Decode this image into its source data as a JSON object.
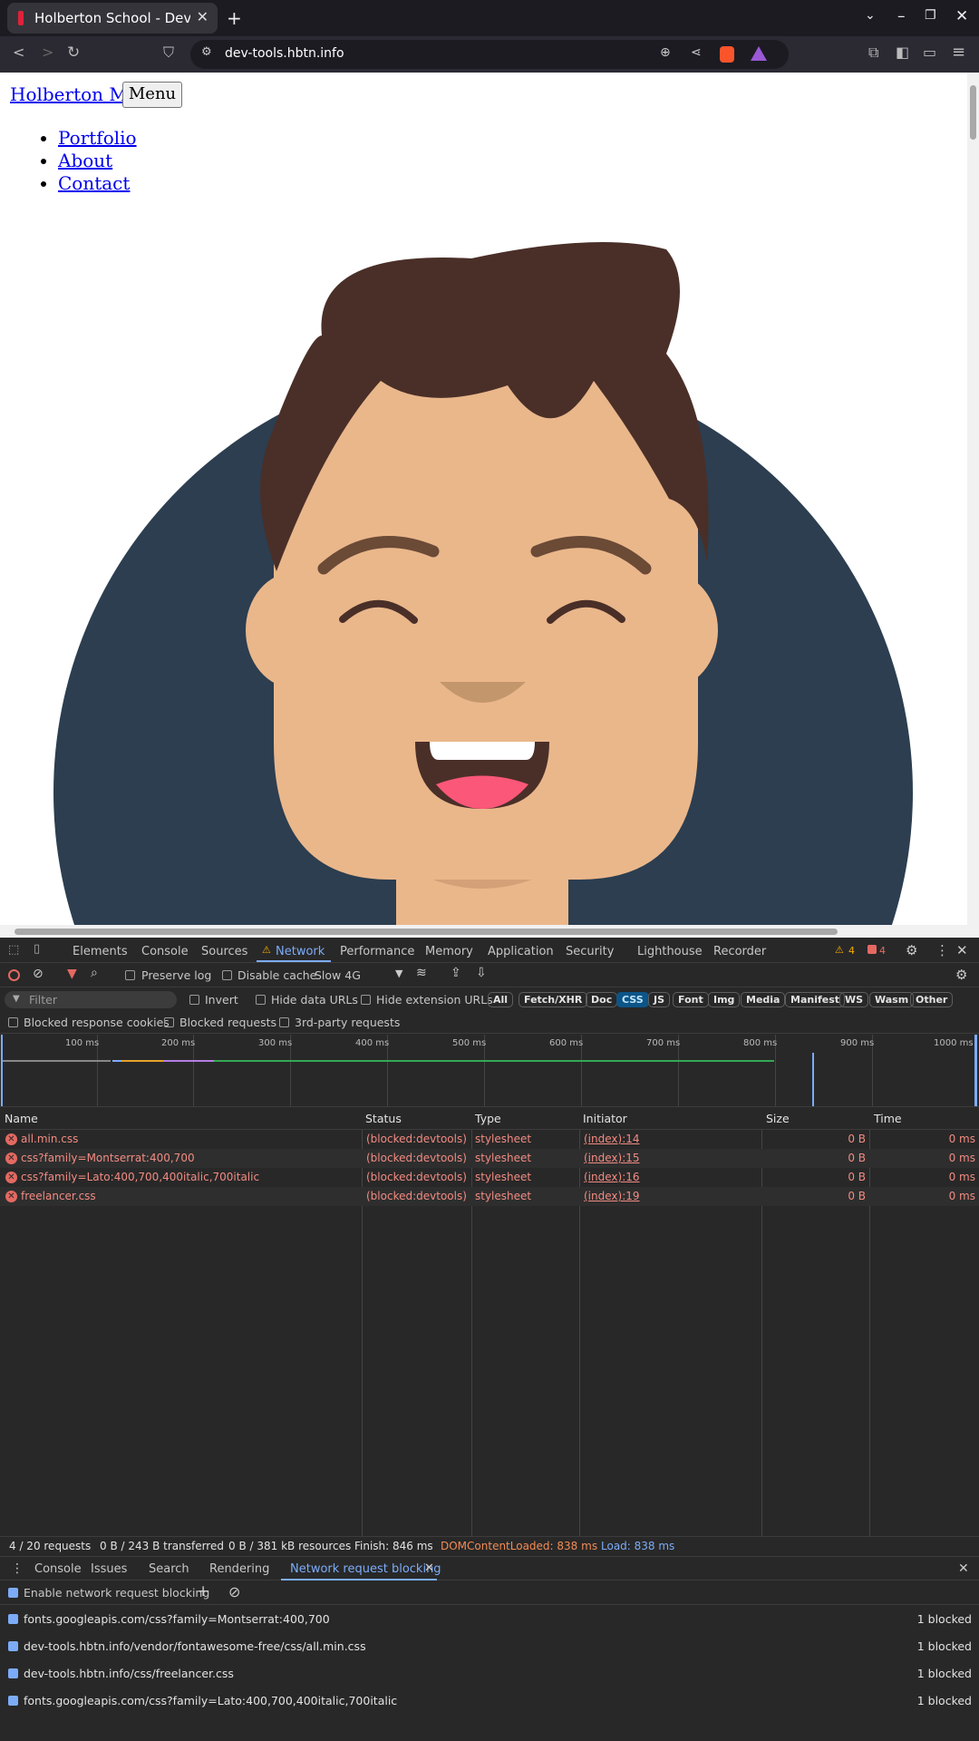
{
  "browser": {
    "tab_title": "Holberton School - Deve",
    "url": "dev-tools.hbtn.info"
  },
  "page": {
    "site_title": "Holberton Me",
    "menu_button": "Menu",
    "nav_links": [
      "Portfolio",
      "About",
      "Contact"
    ]
  },
  "devtools": {
    "tabs": [
      "Elements",
      "Console",
      "Sources",
      "Network",
      "Performance",
      "Memory",
      "Application",
      "Security",
      "Lighthouse",
      "Recorder"
    ],
    "active_tab": "Network",
    "warnings_count": "4",
    "errors_count": "4",
    "toolbar": {
      "preserve_log": "Preserve log",
      "disable_cache": "Disable cache",
      "throttle": "Slow 4G"
    },
    "filter": {
      "placeholder": "Filter",
      "invert": "Invert",
      "hide_data_urls": "Hide data URLs",
      "hide_extension_urls": "Hide extension URLs",
      "types": [
        "All",
        "Fetch/XHR",
        "Doc",
        "CSS",
        "JS",
        "Font",
        "Img",
        "Media",
        "Manifest",
        "WS",
        "Wasm",
        "Other"
      ],
      "active_type": "CSS"
    },
    "options": {
      "blocked_cookies": "Blocked response cookies",
      "blocked_requests": "Blocked requests",
      "third_party": "3rd-party requests"
    },
    "timeline_ticks": [
      "100 ms",
      "200 ms",
      "300 ms",
      "400 ms",
      "500 ms",
      "600 ms",
      "700 ms",
      "800 ms",
      "900 ms",
      "1000 ms"
    ],
    "columns": [
      "Name",
      "Status",
      "Type",
      "Initiator",
      "Size",
      "Time"
    ],
    "requests": [
      {
        "name": "all.min.css",
        "status": "(blocked:devtools)",
        "type": "stylesheet",
        "initiator": "(index):14",
        "size": "0 B",
        "time": "0 ms"
      },
      {
        "name": "css?family=Montserrat:400,700",
        "status": "(blocked:devtools)",
        "type": "stylesheet",
        "initiator": "(index):15",
        "size": "0 B",
        "time": "0 ms"
      },
      {
        "name": "css?family=Lato:400,700,400italic,700italic",
        "status": "(blocked:devtools)",
        "type": "stylesheet",
        "initiator": "(index):16",
        "size": "0 B",
        "time": "0 ms"
      },
      {
        "name": "freelancer.css",
        "status": "(blocked:devtools)",
        "type": "stylesheet",
        "initiator": "(index):19",
        "size": "0 B",
        "time": "0 ms"
      }
    ],
    "status_bar": {
      "requests": "4 / 20 requests",
      "transferred": "0 B / 243 B transferred",
      "resources": "0 B / 381 kB resources",
      "finish": "Finish: 846 ms",
      "dcl": "DOMContentLoaded: 838 ms",
      "load": "Load: 838 ms"
    },
    "drawer": {
      "tabs": [
        "Console",
        "Issues",
        "Search",
        "Rendering",
        "Network request blocking"
      ],
      "active": "Network request blocking",
      "enable_label": "Enable network request blocking",
      "patterns": [
        {
          "url": "fonts.googleapis.com/css?family=Montserrat:400,700",
          "count": "1 blocked"
        },
        {
          "url": "dev-tools.hbtn.info/vendor/fontawesome-free/css/all.min.css",
          "count": "1 blocked"
        },
        {
          "url": "dev-tools.hbtn.info/css/freelancer.css",
          "count": "1 blocked"
        },
        {
          "url": "fonts.googleapis.com/css?family=Lato:400,700,400italic,700italic",
          "count": "1 blocked"
        }
      ]
    }
  },
  "colors": {
    "accent": "#7cacf8",
    "error": "#e46962",
    "warning": "#f9ab00",
    "dcl": "#f28b54"
  }
}
